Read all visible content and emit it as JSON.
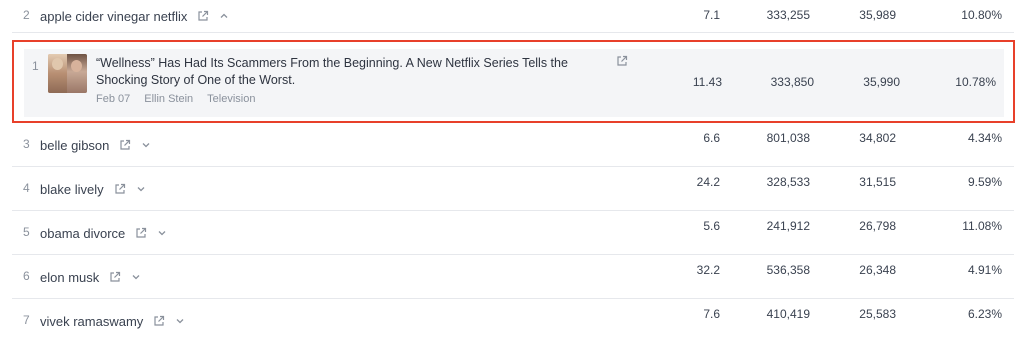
{
  "icons": {
    "external": "external-link-icon",
    "chevron_down": "chevron-down-icon",
    "chevron_up": "chevron-up-icon"
  },
  "highlight_color": "#e8402a",
  "top_row": {
    "rank": "2",
    "keyword": "apple cider vinegar netflix",
    "values": [
      "7.1",
      "333,255",
      "35,989",
      "10.80%"
    ]
  },
  "article": {
    "rank": "1",
    "title": "“Wellness” Has Had Its Scammers From the Beginning. A New Netflix Series Tells the Shocking Story of One of the Worst.",
    "date": "Feb 07",
    "author": "Ellin Stein",
    "category": "Television",
    "values": [
      "11.43",
      "333,850",
      "35,990",
      "10.78%"
    ]
  },
  "rows": [
    {
      "rank": "3",
      "keyword": "belle gibson",
      "values": [
        "6.6",
        "801,038",
        "34,802",
        "4.34%"
      ]
    },
    {
      "rank": "4",
      "keyword": "blake lively",
      "values": [
        "24.2",
        "328,533",
        "31,515",
        "9.59%"
      ]
    },
    {
      "rank": "5",
      "keyword": "obama divorce",
      "values": [
        "5.6",
        "241,912",
        "26,798",
        "11.08%"
      ]
    },
    {
      "rank": "6",
      "keyword": "elon musk",
      "values": [
        "32.2",
        "536,358",
        "26,348",
        "4.91%"
      ]
    },
    {
      "rank": "7",
      "keyword": "vivek ramaswamy",
      "values": [
        "7.6",
        "410,419",
        "25,583",
        "6.23%"
      ]
    }
  ]
}
